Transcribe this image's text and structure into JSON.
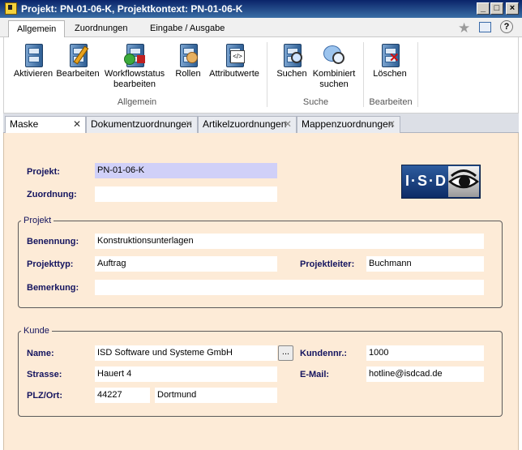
{
  "window": {
    "title": "Projekt: PN-01-06-K, Projektkontext: PN-01-06-K",
    "minimize": "_",
    "maximize": "□",
    "close": "×"
  },
  "ribbon_tabs": [
    "Allgemein",
    "Zuordnungen",
    "Eingabe / Ausgabe"
  ],
  "ribbon_help": "?",
  "ribbon": {
    "groups": [
      {
        "label": "Allgemein",
        "buttons": [
          "Aktivieren",
          "Bearbeiten",
          "Workflowstatus bearbeiten",
          "Rollen",
          "Attributwerte"
        ]
      },
      {
        "label": "Suche",
        "buttons": [
          "Suchen",
          "Kombiniert suchen"
        ]
      },
      {
        "label": "Bearbeiten",
        "buttons": [
          "Löschen"
        ]
      }
    ]
  },
  "doc_tabs": [
    "Maske",
    "Dokumentzuordnungen",
    "Artikelzuordnungen",
    "Mappenzuordnungen"
  ],
  "form": {
    "projekt_label": "Projekt:",
    "projekt_value": "PN-01-06-K",
    "zuordnung_label": "Zuordnung:",
    "zuordnung_value": "",
    "logo_text": "I·S·D",
    "projekt_group": {
      "legend": "Projekt",
      "benennung_label": "Benennung:",
      "benennung_value": "Konstruktionsunterlagen",
      "projekttyp_label": "Projekttyp:",
      "projekttyp_value": "Auftrag",
      "projektleiter_label": "Projektleiter:",
      "projektleiter_value": "Buchmann",
      "bemerkung_label": "Bemerkung:",
      "bemerkung_value": ""
    },
    "kunde_group": {
      "legend": "Kunde",
      "name_label": "Name:",
      "name_value": "ISD Software und Systeme GmbH",
      "browse_label": "...",
      "kundennr_label": "Kundennr.:",
      "kundennr_value": "1000",
      "strasse_label": "Strasse:",
      "strasse_value": "Hauert 4",
      "email_label": "E-Mail:",
      "email_value": "hotline@isdcad.de",
      "plzort_label": "PLZ/Ort:",
      "plz_value": "44227",
      "ort_value": "Dortmund"
    }
  }
}
